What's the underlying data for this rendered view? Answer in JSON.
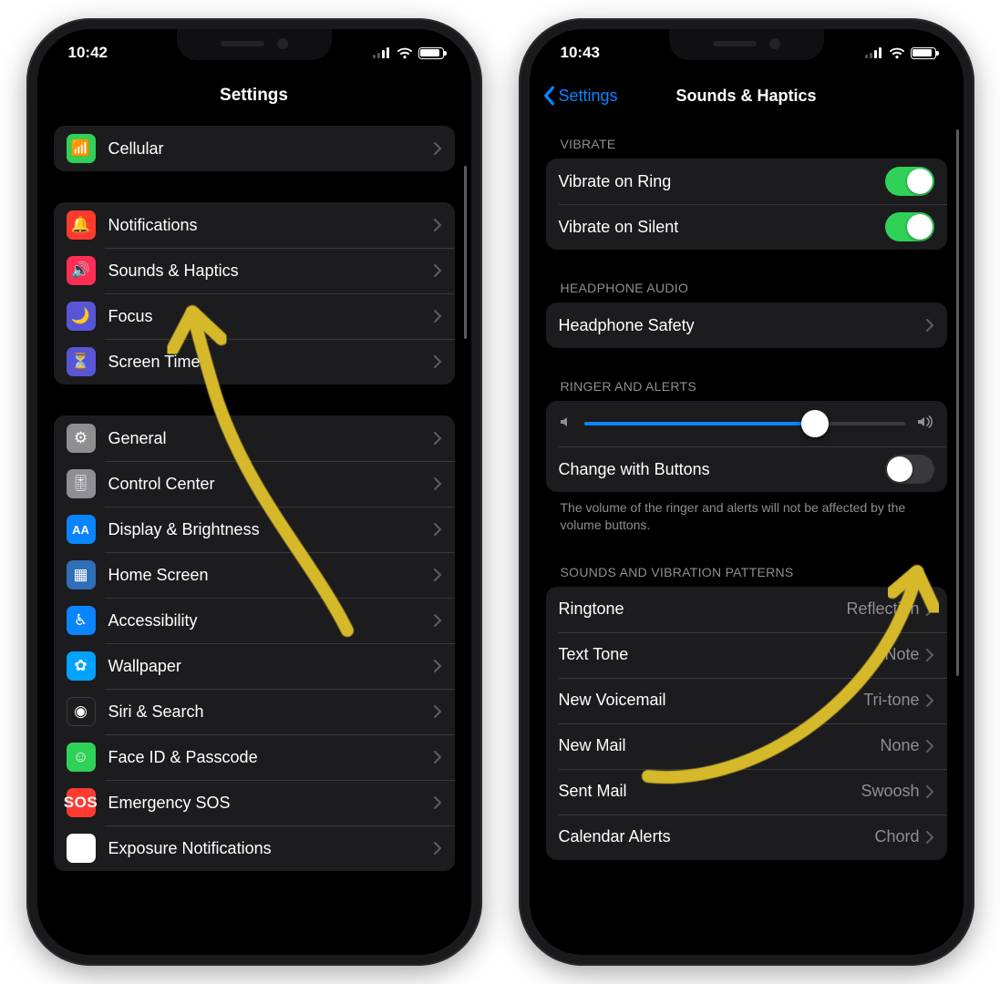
{
  "left": {
    "time": "10:42",
    "title": "Settings",
    "groups": [
      {
        "rows": [
          {
            "key": "cellular",
            "label": "Cellular",
            "iconColor": "ic-green",
            "glyph": "📶"
          }
        ]
      },
      {
        "rows": [
          {
            "key": "notifications",
            "label": "Notifications",
            "iconColor": "ic-red",
            "glyph": "🔔"
          },
          {
            "key": "sounds-haptics",
            "label": "Sounds & Haptics",
            "iconColor": "ic-pink",
            "glyph": "🔊"
          },
          {
            "key": "focus",
            "label": "Focus",
            "iconColor": "ic-indigo",
            "glyph": "🌙"
          },
          {
            "key": "screen-time",
            "label": "Screen Time",
            "iconColor": "ic-indigo",
            "glyph": "⏳"
          }
        ]
      },
      {
        "rows": [
          {
            "key": "general",
            "label": "General",
            "iconColor": "ic-gray",
            "glyph": "⚙︎"
          },
          {
            "key": "control-center",
            "label": "Control Center",
            "iconColor": "ic-gray2",
            "glyph": "🎚"
          },
          {
            "key": "display-brightness",
            "label": "Display & Brightness",
            "iconColor": "ic-blue",
            "glyph": "AA"
          },
          {
            "key": "home-screen",
            "label": "Home Screen",
            "iconColor": "ic-bluedark",
            "glyph": "▦"
          },
          {
            "key": "accessibility",
            "label": "Accessibility",
            "iconColor": "ic-blue",
            "glyph": "♿︎"
          },
          {
            "key": "wallpaper",
            "label": "Wallpaper",
            "iconColor": "ic-cyan",
            "glyph": "✿"
          },
          {
            "key": "siri-search",
            "label": "Siri & Search",
            "iconColor": "ic-black",
            "glyph": "◉"
          },
          {
            "key": "face-id",
            "label": "Face ID & Passcode",
            "iconColor": "ic-green",
            "glyph": "☺︎"
          },
          {
            "key": "emergency-sos",
            "label": "Emergency SOS",
            "iconColor": "ic-sos",
            "glyph": "SOS"
          },
          {
            "key": "exposure",
            "label": "Exposure Notifications",
            "iconColor": "ic-white",
            "glyph": "⠿"
          }
        ]
      }
    ]
  },
  "right": {
    "time": "10:43",
    "back": "Settings",
    "title": "Sounds & Haptics",
    "vibrate_header": "VIBRATE",
    "vibrate_ring": {
      "label": "Vibrate on Ring",
      "value": true
    },
    "vibrate_silent": {
      "label": "Vibrate on Silent",
      "value": true
    },
    "headphone_header": "HEADPHONE AUDIO",
    "headphone_safety": "Headphone Safety",
    "ringer_header": "RINGER AND ALERTS",
    "ringer_volume_percent": 72,
    "change_buttons": {
      "label": "Change with Buttons",
      "value": false
    },
    "ringer_note": "The volume of the ringer and alerts will not be affected by the volume buttons.",
    "patterns_header": "SOUNDS AND VIBRATION PATTERNS",
    "patterns": [
      {
        "key": "ringtone",
        "label": "Ringtone",
        "value": "Reflection"
      },
      {
        "key": "text-tone",
        "label": "Text Tone",
        "value": "Note"
      },
      {
        "key": "new-voicemail",
        "label": "New Voicemail",
        "value": "Tri-tone"
      },
      {
        "key": "new-mail",
        "label": "New Mail",
        "value": "None"
      },
      {
        "key": "sent-mail",
        "label": "Sent Mail",
        "value": "Swoosh"
      },
      {
        "key": "calendar-alerts",
        "label": "Calendar Alerts",
        "value": "Chord"
      }
    ]
  }
}
